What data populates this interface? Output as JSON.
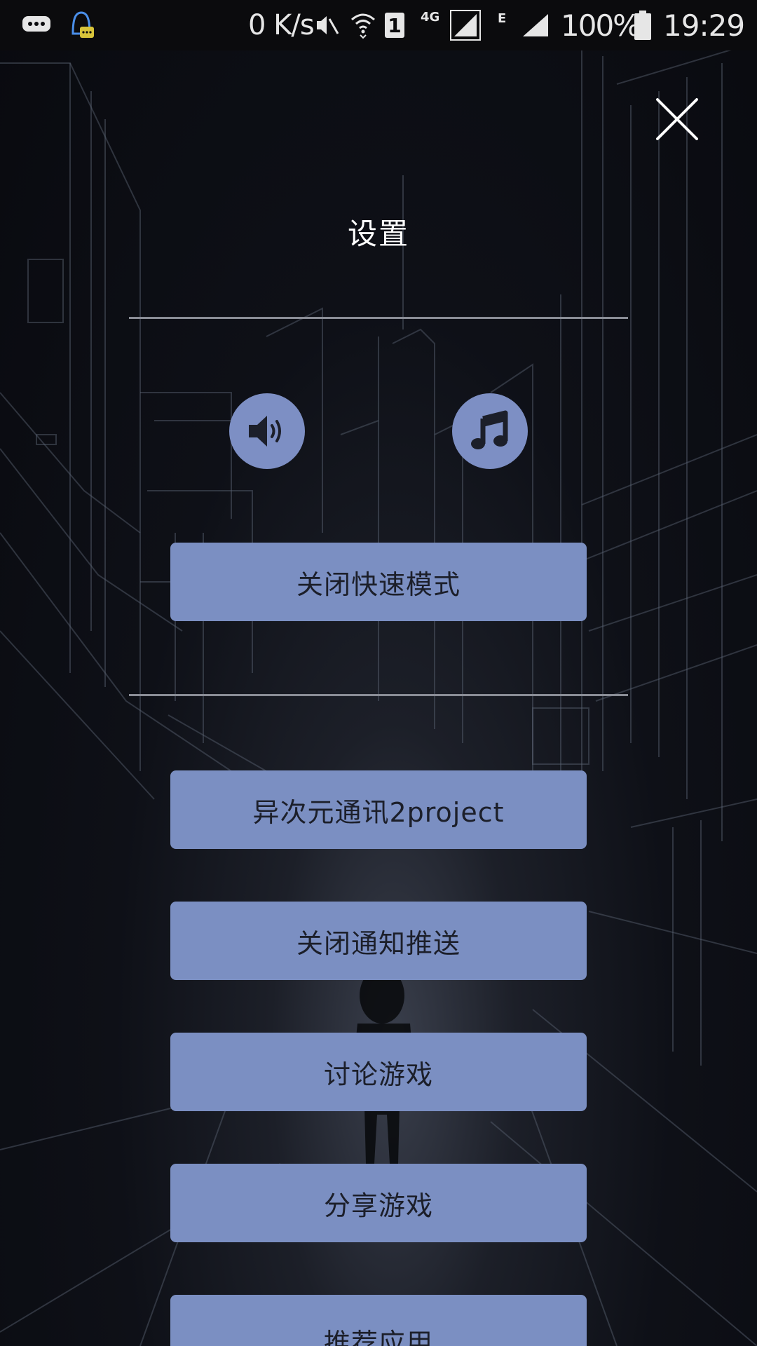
{
  "status_bar": {
    "net_speed": "0 K/s",
    "network_type": "4G",
    "network_secondary": "E",
    "sim_slot": "1",
    "battery_percent": "100%",
    "time": "19:29",
    "icons": [
      "message-icon",
      "qq-notification-icon",
      "mute-icon",
      "wifi-icon",
      "sim-icon",
      "signal-icon",
      "battery-icon"
    ]
  },
  "settings": {
    "title": "设置",
    "close_icon": "close-icon",
    "sound_icon": "speaker-icon",
    "music_icon": "music-note-icon",
    "quick_mode_label": "关闭快速模式",
    "buttons": [
      {
        "label": "异次元通讯2project"
      },
      {
        "label": "关闭通知推送"
      },
      {
        "label": "讨论游戏"
      },
      {
        "label": "分享游戏"
      },
      {
        "label": "推荐应用"
      }
    ]
  },
  "colors": {
    "button_bg": "#7b8fc2",
    "button_text": "#1c1f2a",
    "background": "#0e1017",
    "divider": "#8a8d96"
  }
}
